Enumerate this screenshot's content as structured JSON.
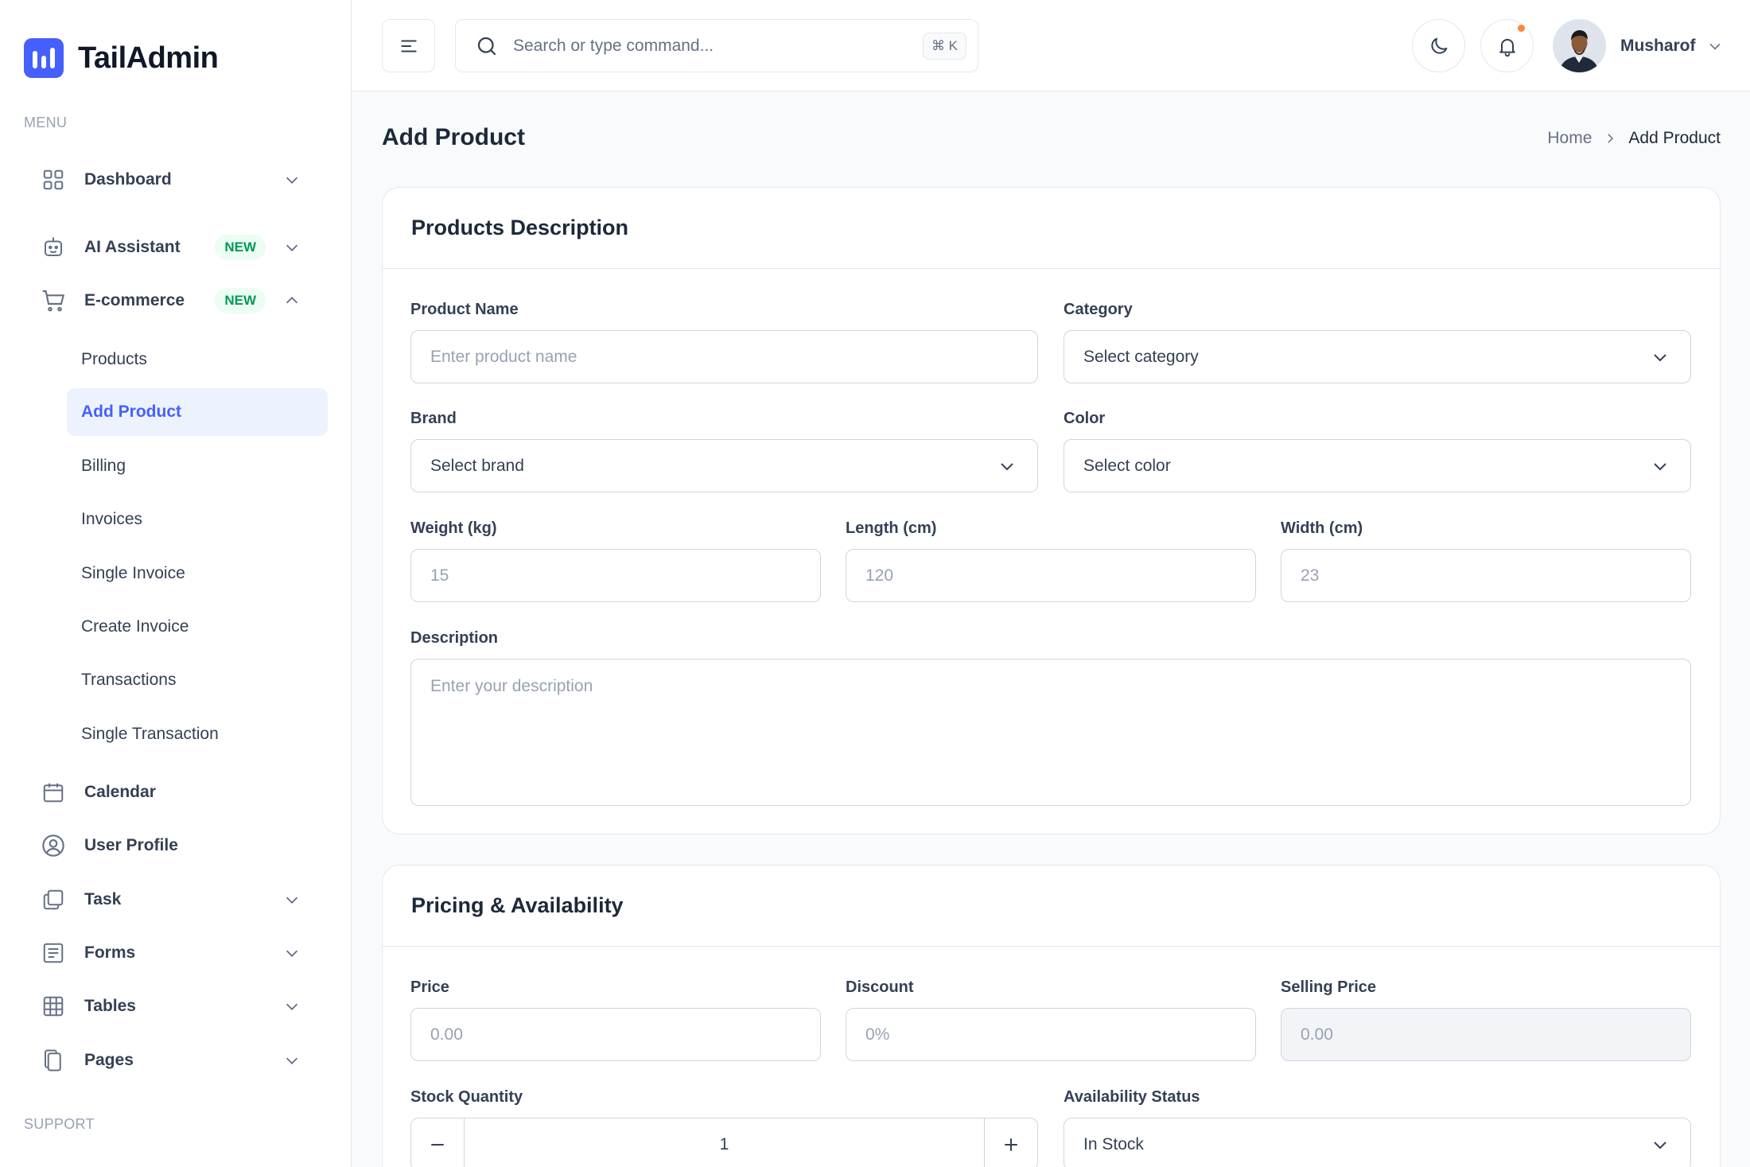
{
  "brand": {
    "name": "TailAdmin"
  },
  "sidebar": {
    "menu_label": "MENU",
    "support_label": "SUPPORT",
    "items": {
      "dashboard": {
        "label": "Dashboard"
      },
      "ai_assistant": {
        "label": "AI Assistant",
        "badge": "NEW"
      },
      "ecommerce": {
        "label": "E-commerce",
        "badge": "NEW"
      },
      "calendar": {
        "label": "Calendar"
      },
      "user_profile": {
        "label": "User Profile"
      },
      "task": {
        "label": "Task"
      },
      "forms": {
        "label": "Forms"
      },
      "tables": {
        "label": "Tables"
      },
      "pages": {
        "label": "Pages"
      }
    },
    "ecommerce_sub": [
      "Products",
      "Add Product",
      "Billing",
      "Invoices",
      "Single Invoice",
      "Create Invoice",
      "Transactions",
      "Single Transaction"
    ]
  },
  "header": {
    "search_placeholder": "Search or type command...",
    "search_shortcut": "⌘ K",
    "user_name": "Musharof"
  },
  "page": {
    "title": "Add Product",
    "breadcrumb": {
      "home": "Home",
      "current": "Add Product"
    }
  },
  "description_card": {
    "title": "Products Description",
    "product_name": {
      "label": "Product Name",
      "placeholder": "Enter product name"
    },
    "category": {
      "label": "Category",
      "value": "Select category"
    },
    "brand": {
      "label": "Brand",
      "value": "Select brand"
    },
    "color": {
      "label": "Color",
      "value": "Select color"
    },
    "weight": {
      "label": "Weight (kg)",
      "placeholder": "15"
    },
    "length": {
      "label": "Length (cm)",
      "placeholder": "120"
    },
    "width": {
      "label": "Width (cm)",
      "placeholder": "23"
    },
    "description": {
      "label": "Description",
      "placeholder": "Enter your description"
    }
  },
  "pricing_card": {
    "title": "Pricing & Availability",
    "price": {
      "label": "Price",
      "placeholder": "0.00"
    },
    "discount": {
      "label": "Discount",
      "placeholder": "0%"
    },
    "selling_price": {
      "label": "Selling Price",
      "placeholder": "0.00"
    },
    "stock": {
      "label": "Stock Quantity",
      "value": "1"
    },
    "availability": {
      "label": "Availability Status",
      "value": "In Stock"
    }
  },
  "colors": {
    "accent": "#465fff",
    "badge_bg": "#ecfdf3",
    "badge_text": "#039855",
    "notification": "#fd853a"
  }
}
